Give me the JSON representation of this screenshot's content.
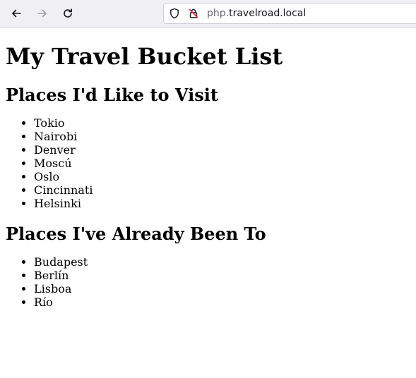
{
  "browser": {
    "url_subdomain": "php.",
    "url_host": "travelroad.local",
    "icons": {
      "back": "arrow-left-icon",
      "forward": "arrow-right-icon",
      "reload": "reload-icon",
      "shield": "shield-icon",
      "insecure": "insecure-lock-icon"
    }
  },
  "page": {
    "title": "My Travel Bucket List",
    "to_visit": {
      "heading": "Places I'd Like to Visit",
      "places": [
        "Tokio",
        "Nairobi",
        "Denver",
        "Moscú",
        "Oslo",
        "Cincinnati",
        "Helsinki"
      ]
    },
    "visited": {
      "heading": "Places I've Already Been To",
      "places": [
        "Budapest",
        "Berlín",
        "Lisboa",
        "Río"
      ]
    }
  },
  "colors": {
    "toolbar_bg": "#f0f0f4",
    "text": "#000000",
    "url_muted": "#6b6b75"
  }
}
